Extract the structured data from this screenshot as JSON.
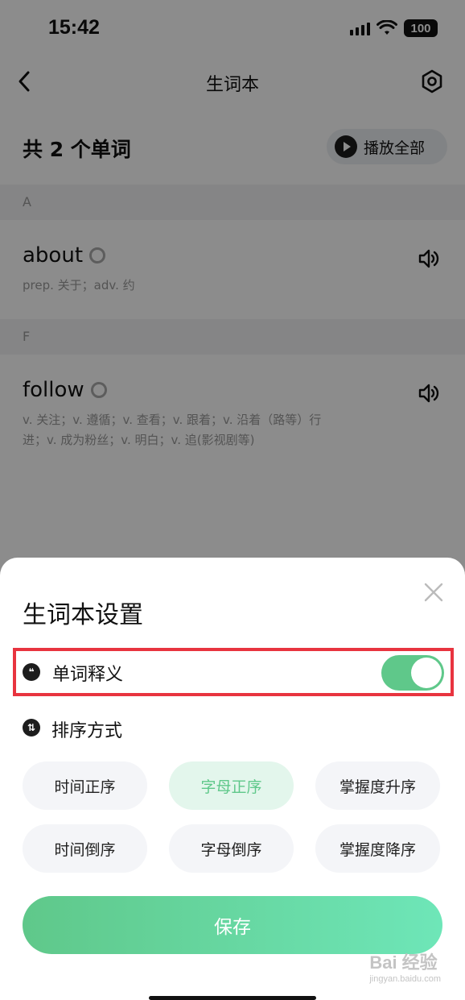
{
  "status": {
    "time": "15:42",
    "battery": "100"
  },
  "nav": {
    "title": "生词本"
  },
  "summary": {
    "count_text": "共 2 个单词",
    "play_all": "播放全部"
  },
  "sections": [
    {
      "letter": "A",
      "words": [
        {
          "word": "about",
          "definition": "prep. 关于；adv. 约"
        }
      ]
    },
    {
      "letter": "F",
      "words": [
        {
          "word": "follow",
          "definition": "v. 关注；v. 遵循；v. 查看；v. 跟着；v. 沿着（路等）行进；v. 成为粉丝；v. 明白；v. 追(影视剧等)"
        }
      ]
    }
  ],
  "sheet": {
    "title": "生词本设置",
    "meaning_label": "单词释义",
    "meaning_enabled": true,
    "sort_label": "排序方式",
    "sort_options": [
      "时间正序",
      "字母正序",
      "掌握度升序",
      "时间倒序",
      "字母倒序",
      "掌握度降序"
    ],
    "selected_sort": "字母正序",
    "save_label": "保存"
  },
  "watermark": {
    "main": "Bai 经验",
    "sub": "jingyan.baidu.com"
  },
  "colors": {
    "accent": "#5fc88a",
    "highlight_border": "#e8343f"
  }
}
